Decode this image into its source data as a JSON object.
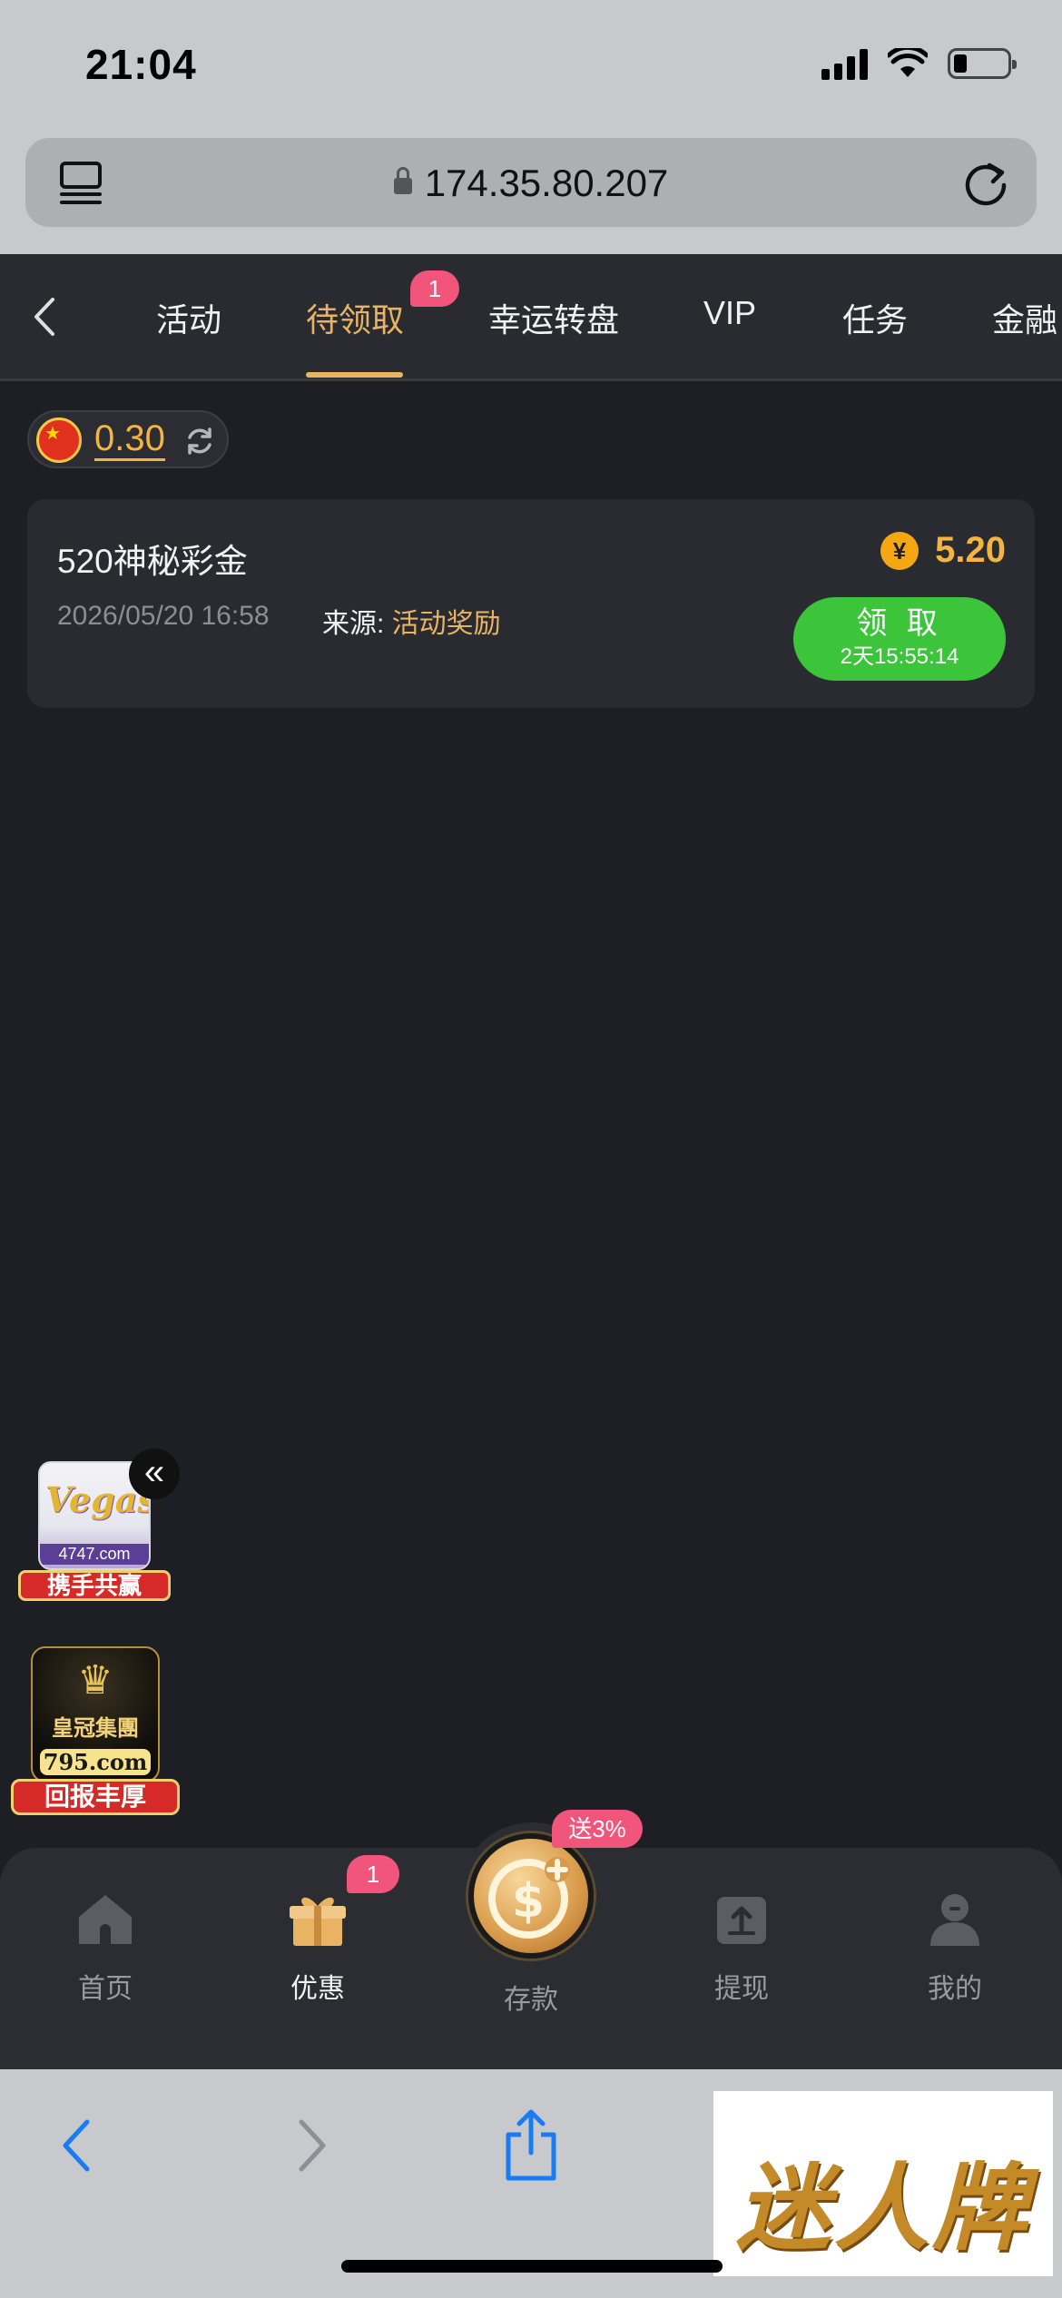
{
  "status_bar": {
    "time": "21:04"
  },
  "browser": {
    "url": "174.35.80.207"
  },
  "nav": {
    "tabs": [
      {
        "label": "活动",
        "active": false
      },
      {
        "label": "待领取",
        "active": true,
        "badge": "1"
      },
      {
        "label": "幸运转盘",
        "active": false
      },
      {
        "label": "VIP",
        "active": false
      },
      {
        "label": "任务",
        "active": false
      },
      {
        "label": "金融",
        "active": false
      }
    ]
  },
  "balance": {
    "value": "0.30",
    "flag": "china-flag-icon"
  },
  "reward": {
    "title": "520神秘彩金",
    "datetime": "2026/05/20 16:58",
    "source_label": "来源: ",
    "source_value": "活动奖励",
    "currency_symbol": "¥",
    "amount": "5.20",
    "claim_label": "领 取",
    "claim_countdown": "2天15:55:14"
  },
  "floating_ads": {
    "vegas": {
      "logo": "Vegas",
      "domain": "4747.com",
      "banner": "携手共赢"
    },
    "crown": {
      "name": "皇冠集團",
      "domain": "795.com",
      "banner": "回报丰厚"
    }
  },
  "tab_bar": {
    "items": [
      {
        "label": "首页",
        "icon": "home-icon",
        "active": false
      },
      {
        "label": "优惠",
        "icon": "gift-icon",
        "active": true,
        "badge": "1"
      },
      {
        "label": "存款",
        "icon": "deposit-coin-icon",
        "active": false,
        "promo": "送3%"
      },
      {
        "label": "提现",
        "icon": "withdraw-icon",
        "active": false
      },
      {
        "label": "我的",
        "icon": "profile-icon",
        "active": false
      }
    ]
  },
  "watermark": {
    "text": "迷人牌"
  },
  "colors": {
    "accent_gold": "#e8b463",
    "amount_gold": "#f3b53f",
    "claim_green": "#3cc43a",
    "badge_pink": "#f2557b",
    "background": "#1e1f24"
  }
}
